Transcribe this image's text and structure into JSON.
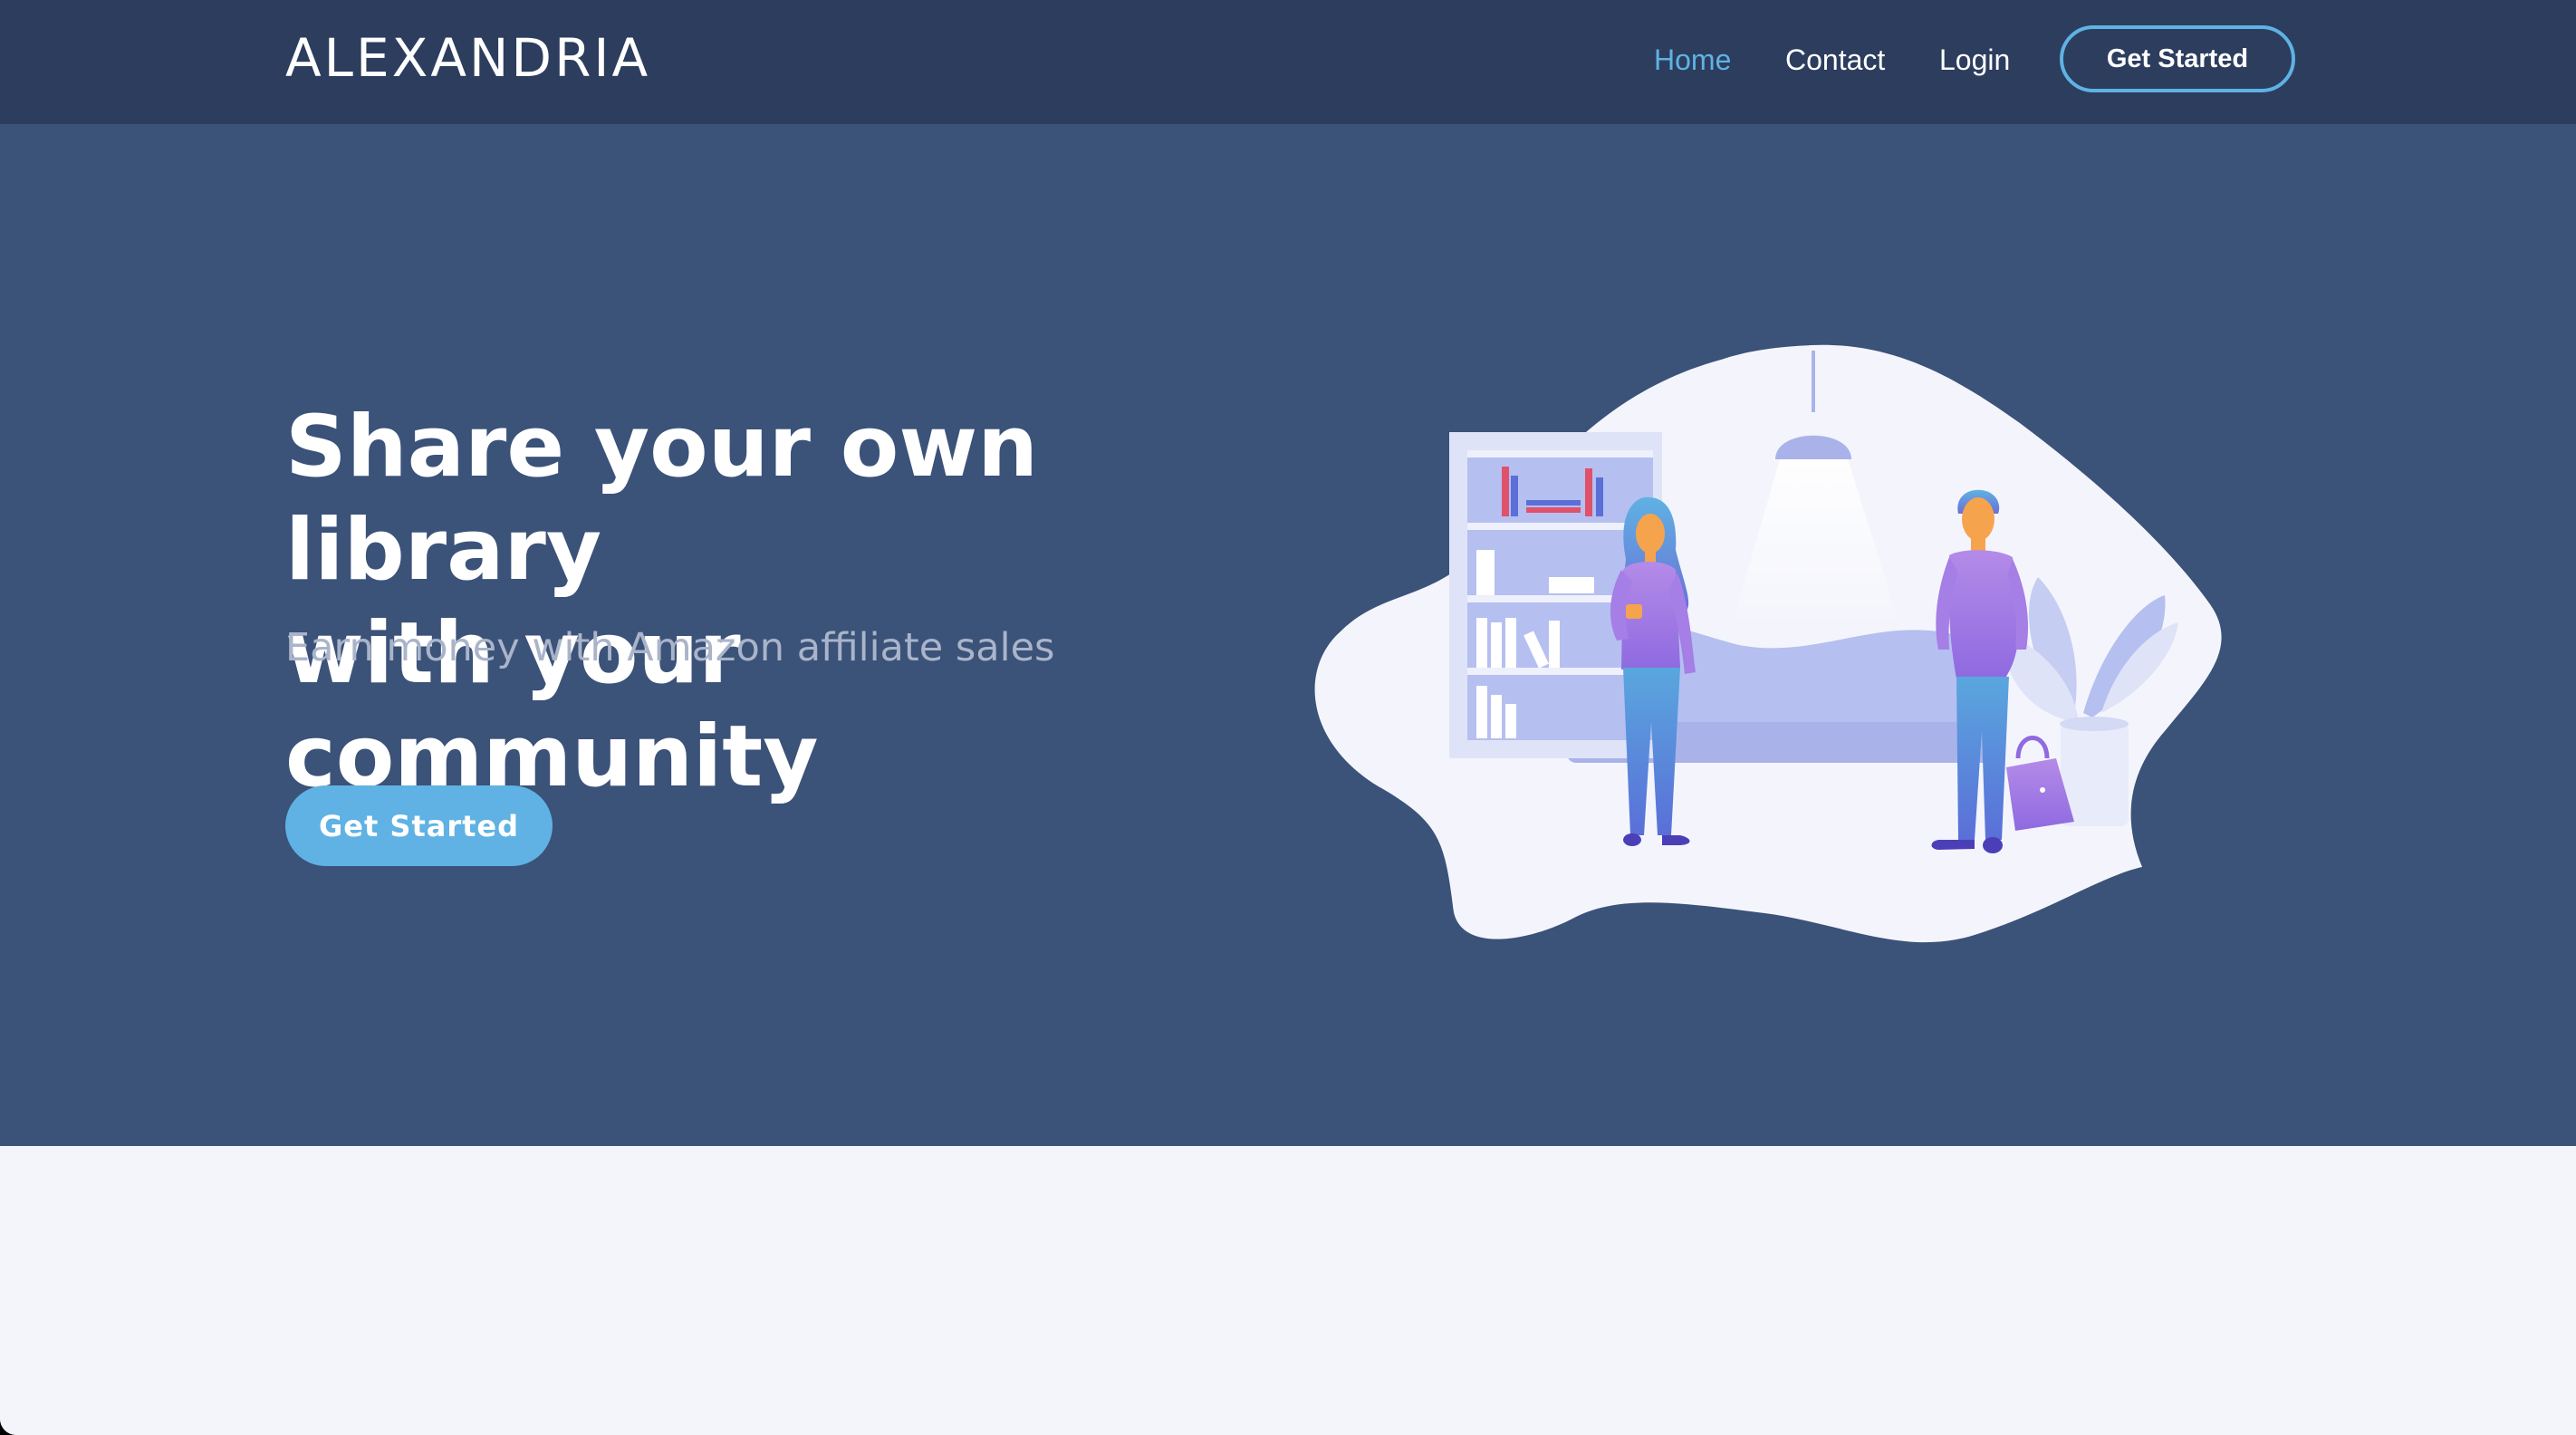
{
  "nav": {
    "logo": "ALEXANDRIA",
    "links": [
      {
        "label": "Home",
        "active": true
      },
      {
        "label": "Contact",
        "active": false
      },
      {
        "label": "Login",
        "active": false
      }
    ],
    "cta_label": "Get Started"
  },
  "hero": {
    "title_line1": "Share your own library",
    "title_line2": "with your community",
    "subtitle": "Earn money with Amazon affiliate sales",
    "cta_label": "Get Started",
    "illustration": "library-people-illustration"
  },
  "colors": {
    "navbar_bg": "#2c3d5e",
    "hero_bg": "#3b5279",
    "accent": "#5fb2e3",
    "page_bg": "#f4f5fa"
  }
}
